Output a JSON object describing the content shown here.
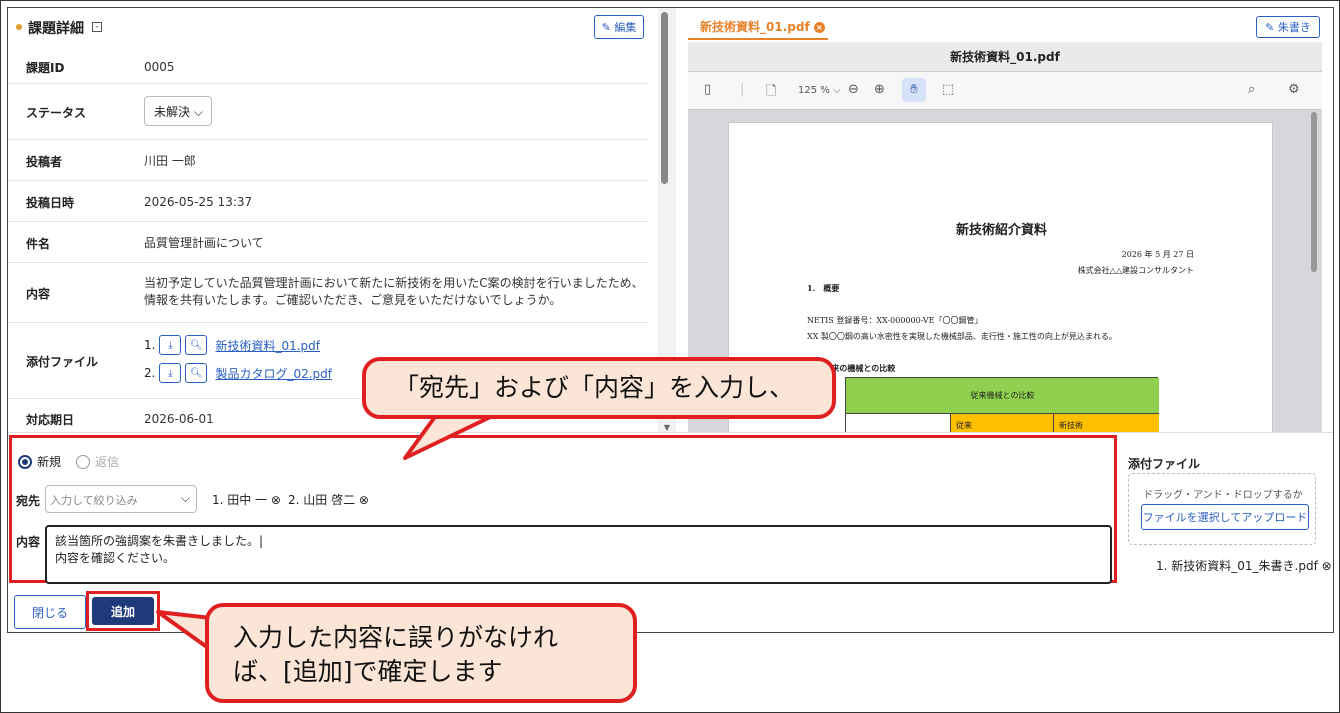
{
  "issue_detail": {
    "title": "課題詳細",
    "collapse_glyph": "-",
    "edit_label": "✎ 編集",
    "rows": {
      "id": {
        "label": "課題ID",
        "value": "0005"
      },
      "status": {
        "label": "ステータス",
        "value": "未解決 ⌵"
      },
      "poster": {
        "label": "投稿者",
        "value": "川田 一郎"
      },
      "date": {
        "label": "投稿日時",
        "value": "2026-05-25 13:37"
      },
      "subject": {
        "label": "件名",
        "value": "品質管理計画について"
      },
      "content": {
        "label": "内容",
        "line1": "当初予定していた品質管理計画において新たに新技術を用いたC案の検討を行いましたため、",
        "line2": "情報を共有いたします。ご確認いただき、ご意見をいただけないでしょうか。"
      },
      "attachments": {
        "label": "添付ファイル",
        "items": [
          {
            "num": "1.",
            "name": "新技術資料_01.pdf"
          },
          {
            "num": "2.",
            "name": "製品カタログ_02.pdf"
          }
        ]
      },
      "due": {
        "label": "対応期日",
        "value": "2026-06-01"
      }
    }
  },
  "viewer": {
    "tab_name": "新技術資料_01.pdf",
    "tab_close": "×",
    "markup_label": "✎ 朱書き",
    "pdf_title": "新技術資料_01.pdf",
    "zoom": "125 % ⌵",
    "page": {
      "heading": "新技術紹介資料",
      "date": "2026 年 5 月 27 日",
      "company": "株式会社△△建設コンサルタント",
      "section1": "1.　概要",
      "line_netis": "NETIS 登録番号：XX-000000-VE「〇〇鋼管」",
      "line_desc": "XX 製〇〇鋼の高い水密性を実現した機械部品、走行性・施工性の向上が見込まれる。",
      "section2": "2.　従来の機械との比較",
      "table_header": "従来機械との比較",
      "col_old": "従来",
      "col_new": "新技術"
    }
  },
  "form": {
    "mode_new": "新規",
    "mode_reply": "返信",
    "dest_label": "宛先",
    "dest_placeholder": "入力して絞り込み",
    "dest_chevron": "⌵",
    "recipients": [
      "1. 田中 一 ⊗",
      "2. 山田 啓二 ⊗"
    ],
    "content_label": "内容",
    "content_value": "該当箇所の強調案を朱書きしました。|\n内容を確認ください。",
    "close_label": "閉じる",
    "add_label": "追加",
    "attach_title": "添付ファイル",
    "drop_text": "ドラッグ・アンド・ドロップするか",
    "upload_label": "ファイルを選択してアップロード",
    "attached_file": "1. 新技術資料_01_朱書き.pdf ⊗"
  },
  "callouts": {
    "top": "「宛先」および「内容」を入力し、",
    "bottom_line1": "入力した内容に誤りがなけれ",
    "bottom_line2": "ば、[追加]で確定します"
  },
  "colors": {
    "accent": "#2a5fc4",
    "primary_button": "#1e3a7a",
    "highlight": "#e02020",
    "tab_active": "#e8822a",
    "callout_fill": "#fbe5d6"
  }
}
